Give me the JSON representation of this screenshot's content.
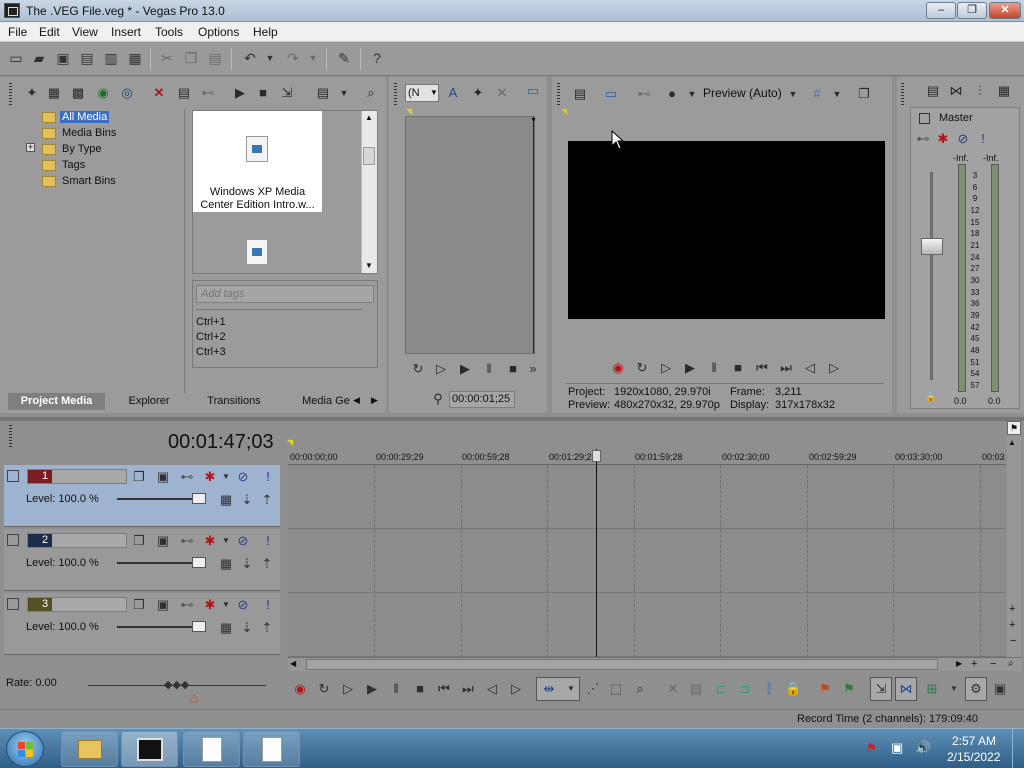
{
  "window": {
    "title": "The .VEG File.veg * - Vegas Pro 13.0",
    "min": "‒",
    "max": "❐",
    "close": "✕"
  },
  "menu": [
    "File",
    "Edit",
    "View",
    "Insert",
    "Tools",
    "Options",
    "Help"
  ],
  "media_tree": {
    "items": [
      "All Media",
      "Media Bins",
      "By Type",
      "Tags",
      "Smart Bins"
    ],
    "expander": "+"
  },
  "media_file": {
    "name": "Windows XP Media Center Edition Intro.w..."
  },
  "tags": {
    "placeholder": "Add tags",
    "shortcuts": [
      "Ctrl+1",
      "Ctrl+2",
      "Ctrl+3"
    ]
  },
  "window_tabs": [
    "Project Media",
    "Explorer",
    "Transitions",
    "Media Ge"
  ],
  "trimmer": {
    "combo": "(N",
    "timecode": "00:00:01;25"
  },
  "preview": {
    "mode": "Preview (Auto)",
    "project_label": "Project:",
    "project_value": "1920x1080, 29.970i",
    "preview_label": "Preview:",
    "preview_value": "480x270x32, 29.970p",
    "frame_label": "Frame:",
    "frame_value": "3,211",
    "display_label": "Display:",
    "display_value": "317x178x32"
  },
  "mixer": {
    "title": "Master",
    "left_peak": "-Inf.",
    "right_peak": "-Inf.",
    "scale": [
      "3",
      "6",
      "9",
      "12",
      "15",
      "18",
      "21",
      "24",
      "27",
      "30",
      "33",
      "36",
      "39",
      "42",
      "45",
      "48",
      "51",
      "54",
      "57"
    ],
    "left_value": "0.0",
    "right_value": "0.0"
  },
  "timeline": {
    "cursor_time": "00:01:47;03",
    "ruler": [
      "00:00:00;00",
      "00:00:29;29",
      "00:00:59;28",
      "00:01:29;2",
      "00:01:59;28",
      "00:02:30;00",
      "00:02:59;29",
      "00:03:30;00",
      "00:03"
    ],
    "tracks": [
      {
        "number": "1",
        "level": "Level: 100.0 %",
        "color": "#7a1c22"
      },
      {
        "number": "2",
        "level": "Level: 100.0 %",
        "color": "#1d2c4a"
      },
      {
        "number": "3",
        "level": "Level: 100.0 %",
        "color": "#545024"
      }
    ]
  },
  "rate": "Rate: 0.00",
  "status": "Record Time (2 channels): 179:09:40",
  "clock": {
    "time": "2:57 AM",
    "date": "2/15/2022"
  }
}
